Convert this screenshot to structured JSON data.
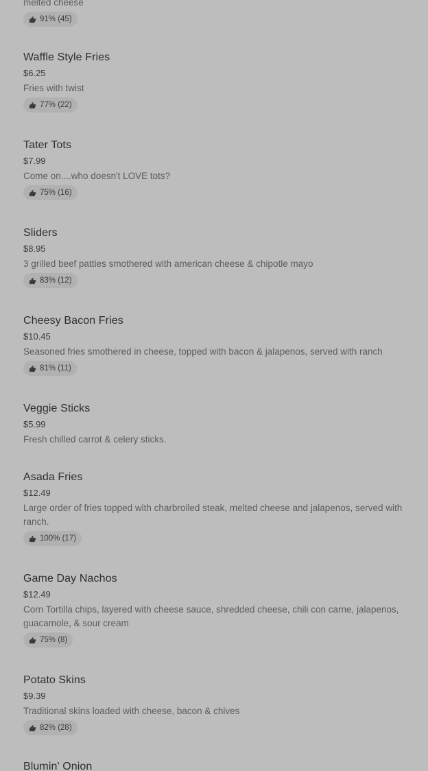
{
  "items": [
    {
      "name": "",
      "price": "",
      "description": "melted cheese",
      "rating": "91% (45)"
    },
    {
      "name": "Waffle Style Fries",
      "price": "$6.25",
      "description": "Fries with twist",
      "rating": "77% (22)"
    },
    {
      "name": "Tater Tots",
      "price": "$7.99",
      "description": "Come on....who doesn't LOVE tots?",
      "rating": "75% (16)"
    },
    {
      "name": "Sliders",
      "price": "$8.95",
      "description": "3 grilled beef patties smothered with american cheese & chipotle mayo",
      "rating": "83% (12)"
    },
    {
      "name": "Cheesy Bacon Fries",
      "price": "$10.45",
      "description": "Seasoned fries smothered in cheese, topped with bacon & jalapenos, served with ranch",
      "rating": "81% (11)"
    },
    {
      "name": "Veggie Sticks",
      "price": "$5.99",
      "description": "Fresh chilled carrot & celery sticks.",
      "rating": ""
    },
    {
      "name": "Asada Fries",
      "price": "$12.49",
      "description": "Large order of fries topped with charbroiled steak, melted cheese and jalapenos, served with ranch.",
      "rating": "100% (17)"
    },
    {
      "name": "Game Day Nachos",
      "price": "$12.49",
      "description": "Corn Tortilla chips, layered with cheese sauce, shredded cheese, chili con carne, jalapenos, guacamole, & sour cream",
      "rating": "75% (8)"
    },
    {
      "name": "Potato Skins",
      "price": "$9.39",
      "description": "Traditional skins loaded with cheese, bacon & chives",
      "rating": "82% (28)"
    },
    {
      "name": "Blumin' Onion",
      "price": "",
      "description": "",
      "rating": ""
    }
  ],
  "icons": {
    "rating": "thumbs-up-icon"
  }
}
